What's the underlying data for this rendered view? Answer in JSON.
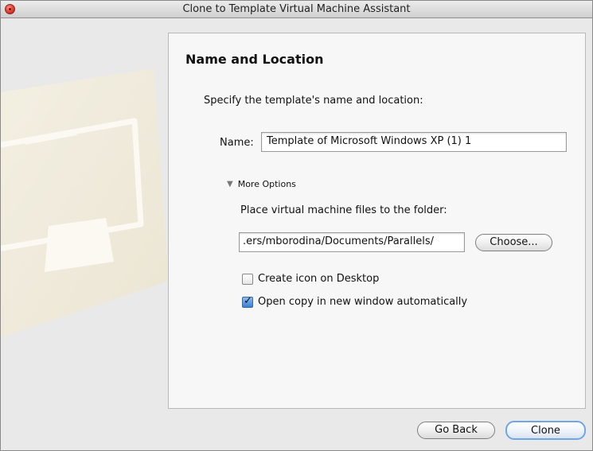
{
  "window": {
    "title": "Clone to Template Virtual Machine Assistant"
  },
  "step": {
    "heading": "Name and Location",
    "subtitle": "Specify the template's name and location:"
  },
  "name_field": {
    "label": "Name:",
    "value": "Template of Microsoft Windows XP (1) 1"
  },
  "more_options": {
    "label": "More Options",
    "expanded": true,
    "folder_label": "Place virtual machine files to the folder:",
    "folder_value": ".ers/mborodina/Documents/Parallels/",
    "choose_label": "Choose..."
  },
  "checkboxes": [
    {
      "label": "Create icon on Desktop",
      "checked": false
    },
    {
      "label": "Open copy in new window automatically",
      "checked": true
    }
  ],
  "footer": {
    "back_label": "Go Back",
    "clone_label": "Clone"
  },
  "colors": {
    "default_button_border": "#6fa6e6",
    "checkbox_checked": "#3c7fd1",
    "close_button": "#e8473a"
  }
}
